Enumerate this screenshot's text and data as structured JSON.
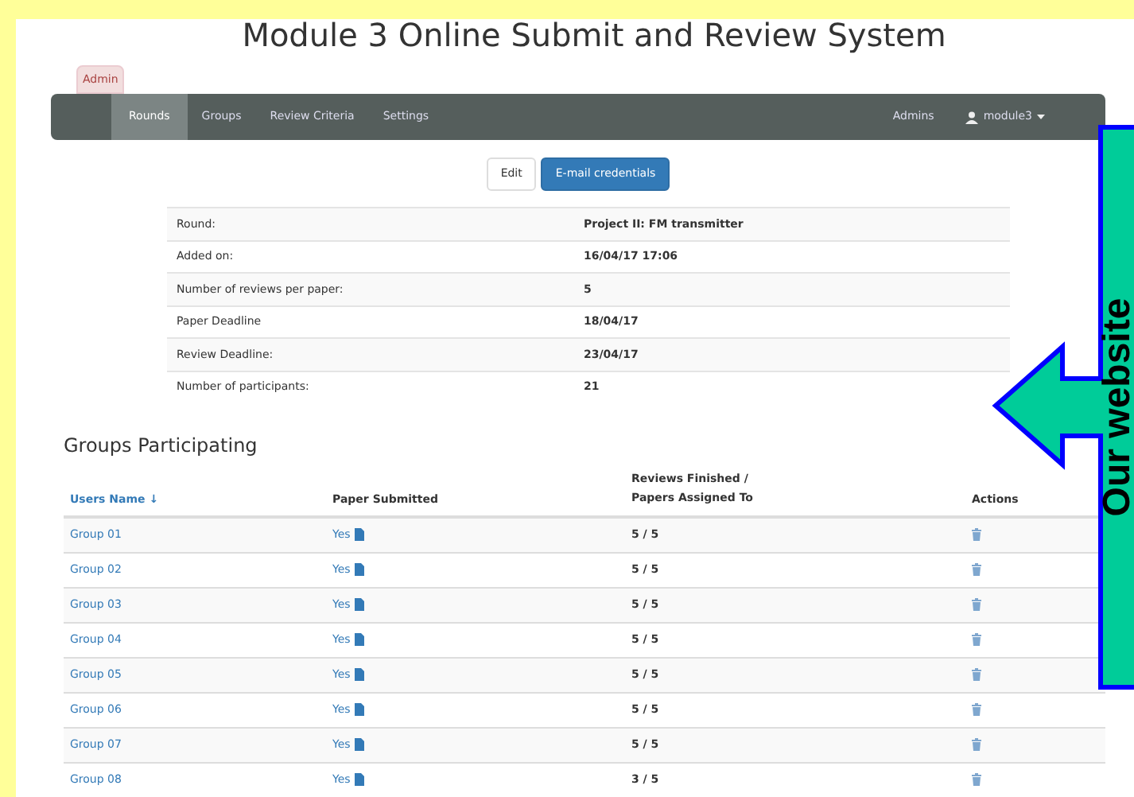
{
  "title": "Module 3 Online Submit and Review System",
  "role_tab": "Admin",
  "nav": {
    "items": [
      {
        "label": "Rounds",
        "selected": true
      },
      {
        "label": "Groups",
        "selected": false
      },
      {
        "label": "Review Criteria",
        "selected": false
      },
      {
        "label": "Settings",
        "selected": false
      }
    ],
    "right": "Admins",
    "user": "module3"
  },
  "buttons": [
    {
      "label": "Edit",
      "kind": "default"
    },
    {
      "label": "E-mail credentials",
      "kind": "primary"
    }
  ],
  "details": [
    {
      "label": "Round:",
      "value": "Project II: FM transmitter"
    },
    {
      "label": "Added on:",
      "value": "16/04/17 17:06"
    },
    {
      "label": "Number of reviews per paper:",
      "value": "5"
    },
    {
      "label": "Paper Deadline",
      "value": "18/04/17"
    },
    {
      "label": "Review Deadline:",
      "value": "23/04/17"
    },
    {
      "label": "Number of participants:",
      "value": "21"
    }
  ],
  "section_title": "Groups Participating",
  "table": {
    "columns": [
      "Users Name ↓",
      "Paper Submitted",
      "Reviews Finished / Papers Assigned To",
      "Actions"
    ],
    "rows": [
      {
        "name": "Group 01",
        "submitted": "Yes",
        "reviews": "5 / 5"
      },
      {
        "name": "Group 02",
        "submitted": "Yes",
        "reviews": "5 / 5"
      },
      {
        "name": "Group 03",
        "submitted": "Yes",
        "reviews": "5 / 5"
      },
      {
        "name": "Group 04",
        "submitted": "Yes",
        "reviews": "5 / 5"
      },
      {
        "name": "Group 05",
        "submitted": "Yes",
        "reviews": "5 / 5"
      },
      {
        "name": "Group 06",
        "submitted": "Yes",
        "reviews": "5 / 5"
      },
      {
        "name": "Group 07",
        "submitted": "Yes",
        "reviews": "5 / 5"
      },
      {
        "name": "Group 08",
        "submitted": "Yes",
        "reviews": "3 / 5"
      }
    ]
  },
  "callout": "Our website"
}
